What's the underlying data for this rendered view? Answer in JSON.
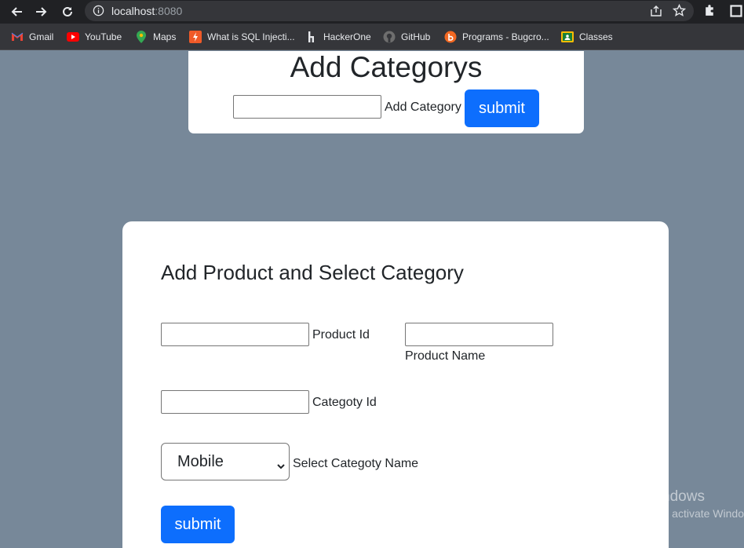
{
  "browser": {
    "url_host": "localhost",
    "url_port": ":8080",
    "bookmarks": [
      {
        "label": "Gmail",
        "icon": "gmail-icon"
      },
      {
        "label": "YouTube",
        "icon": "youtube-icon"
      },
      {
        "label": "Maps",
        "icon": "maps-icon"
      },
      {
        "label": "What is SQL Injecti...",
        "icon": "sql-icon"
      },
      {
        "label": "HackerOne",
        "icon": "hackerone-icon"
      },
      {
        "label": "GitHub",
        "icon": "github-icon"
      },
      {
        "label": "Programs - Bugcro...",
        "icon": "bugcrowd-icon"
      },
      {
        "label": "Classes",
        "icon": "classes-icon"
      }
    ]
  },
  "category_form": {
    "title": "Add Categorys",
    "input_value": "",
    "input_label": "Add Category",
    "submit_label": "submit"
  },
  "product_form": {
    "title": "Add Product and Select Category",
    "product_id_value": "",
    "product_id_label": "Product Id",
    "product_name_value": "",
    "product_name_label": "Product Name",
    "category_id_value": "",
    "category_id_label": "Categoty Id",
    "category_select_value": "Mobile",
    "category_select_label": "Select Categoty Name",
    "submit_label": "submit"
  },
  "watermark": {
    "line1": "Activate Windows",
    "line2": "Go to Settings to activate Windows."
  },
  "colors": {
    "page_bg": "#778899",
    "primary": "#0d6efd",
    "chrome_bg": "#202124"
  }
}
